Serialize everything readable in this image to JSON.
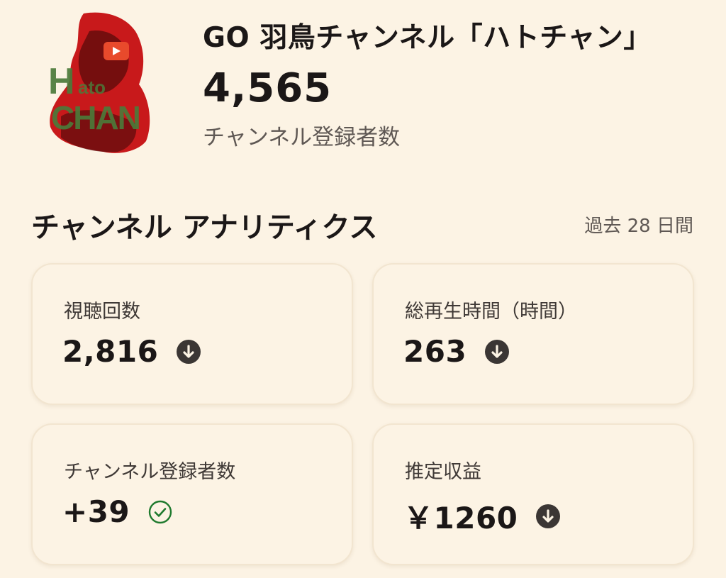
{
  "header": {
    "channel_name": "GO 羽鳥チャンネル「ハトチャン」",
    "subscriber_count": "4,565",
    "subscriber_label": "チャンネル登録者数",
    "avatar_text": "Hato CHAN"
  },
  "analytics": {
    "title": "チャンネル アナリティクス",
    "period": "過去 28 日間",
    "cards": [
      {
        "label": "視聴回数",
        "value": "2,816",
        "trend_icon": "arrow-down-circle-icon"
      },
      {
        "label": "総再生時間（時間）",
        "value": "263",
        "trend_icon": "arrow-down-circle-icon"
      },
      {
        "label": "チャンネル登録者数",
        "value": "+39",
        "trend_icon": "check-circle-icon"
      },
      {
        "label": "推定収益",
        "value": "￥1260",
        "trend_icon": "arrow-down-circle-icon"
      }
    ]
  },
  "colors": {
    "background": "#fcf3e4",
    "text": "#1b1717",
    "secondary_text": "#5f5854",
    "down_icon": "#3b3634",
    "check_icon": "#1f7a2e",
    "avatar_red": "#c8191b",
    "avatar_green": "#4c7a3a"
  }
}
